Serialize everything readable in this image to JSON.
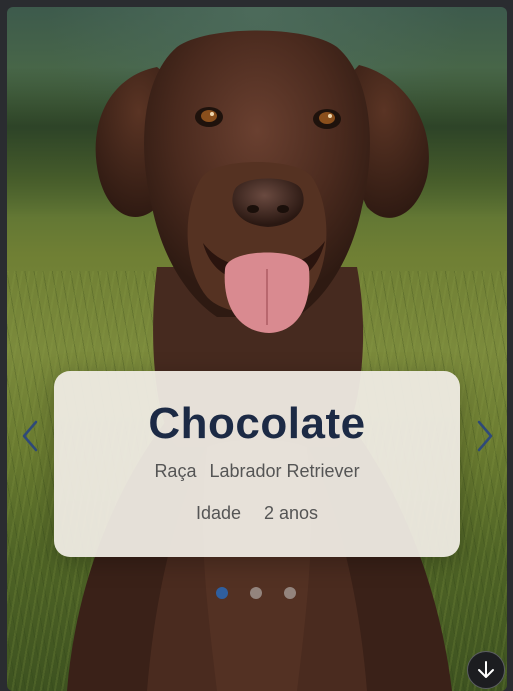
{
  "pet": {
    "name": "Chocolate",
    "breed_label": "Raça",
    "breed_value": "Labrador Retriever",
    "age_label": "Idade",
    "age_value": "2 anos"
  },
  "carousel": {
    "slide_count": 3,
    "active_index": 0
  },
  "icons": {
    "previous": "chevron-left-icon",
    "next": "chevron-right-icon",
    "scroll": "arrow-down-icon"
  },
  "colors": {
    "name_text": "#1c2a45",
    "active_dot": "#2f5f9f",
    "arrow": "#2f4a7a"
  }
}
